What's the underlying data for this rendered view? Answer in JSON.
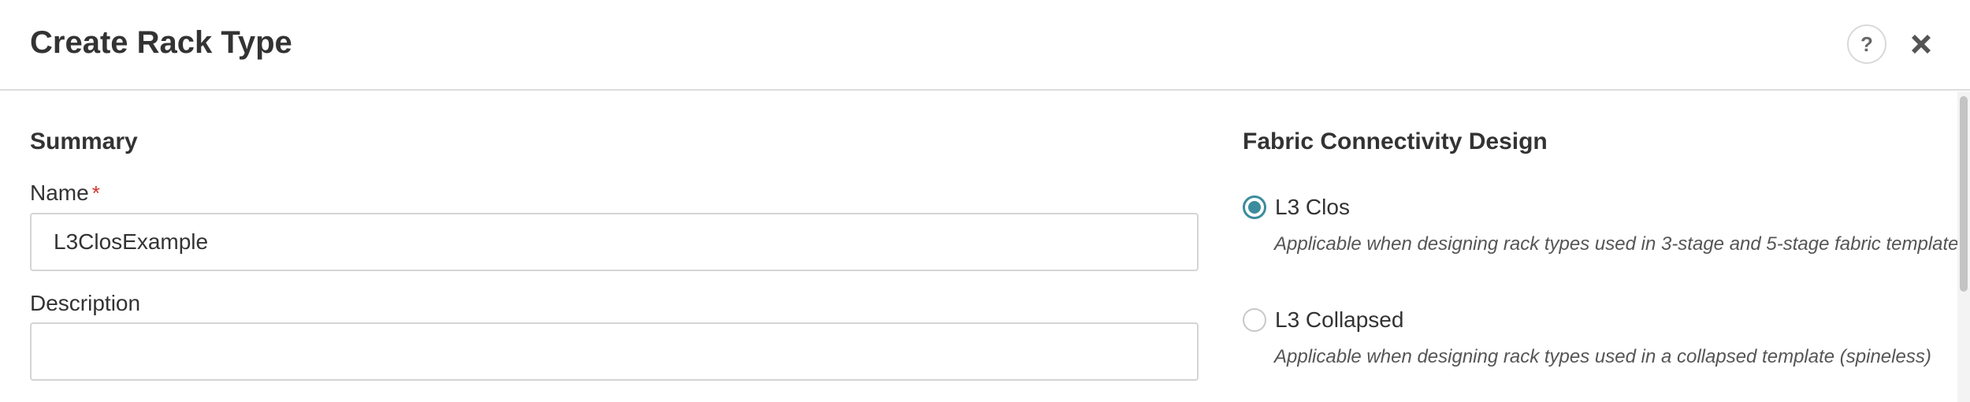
{
  "dialog": {
    "title": "Create Rack Type",
    "help_label": "?",
    "close_icon": "close-icon"
  },
  "summary": {
    "section_title": "Summary",
    "name_label": "Name",
    "name_required_mark": "*",
    "name_value": "L3ClosExample",
    "description_label": "Description",
    "description_value": ""
  },
  "fabric": {
    "section_title": "Fabric Connectivity Design",
    "options": [
      {
        "label": "L3 Clos",
        "description": "Applicable when designing rack types used in 3-stage and 5-stage fabric template",
        "selected": true
      },
      {
        "label": "L3 Collapsed",
        "description": "Applicable when designing rack types used in a collapsed template (spineless)",
        "selected": false
      }
    ]
  },
  "colors": {
    "accent": "#3b8c9c",
    "required": "#d0342c",
    "border": "#d4d4d4"
  }
}
